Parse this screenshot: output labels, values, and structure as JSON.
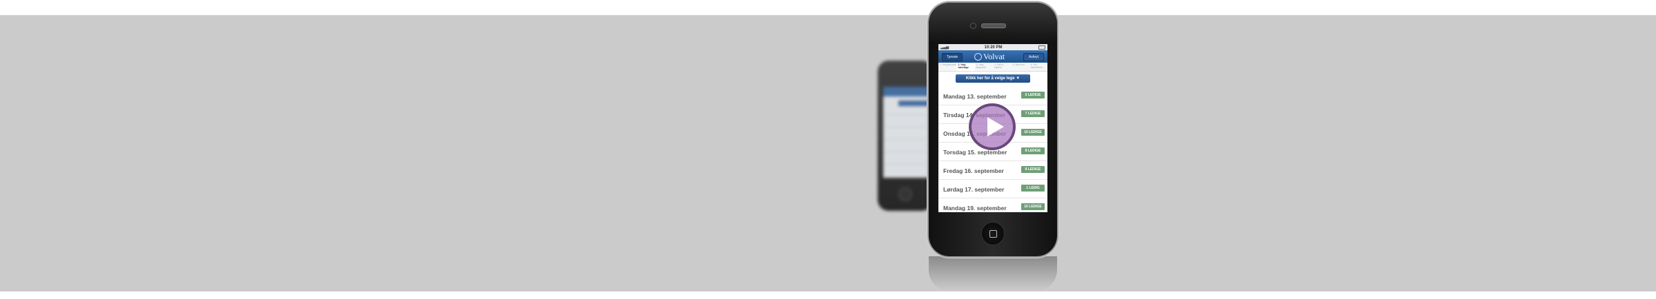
{
  "status_bar": {
    "time": "10:20 PM"
  },
  "nav_bar": {
    "back_label": "Tjenste",
    "logo_text": "Volvat",
    "cancel_label": "Avbryt"
  },
  "steps": [
    {
      "label": "1. Velg tjeneste"
    },
    {
      "label": "2. Velg dato/tage",
      "active": true
    },
    {
      "label": "3. Velg tidspunkt"
    },
    {
      "label": "4. Fyll ut skjema"
    },
    {
      "label": "5. Send inn"
    },
    {
      "label": "6. OK/ bekreftelse"
    }
  ],
  "choose_doctor_button": "Klikk her for å velge lege ▼",
  "days": [
    {
      "label": "Mandag 13. september",
      "badge": "5 LEDIGE"
    },
    {
      "label": "Tirsdag 14. september",
      "badge": "7 LEDIGE"
    },
    {
      "label": "Onsdag 15. september",
      "badge": "10 LEDIGE"
    },
    {
      "label": "Torsdag 15. september",
      "badge": "8 LEDIGE"
    },
    {
      "label": "Fredag 16. september",
      "badge": "8 LEDIGE"
    },
    {
      "label": "Lørdag 17. september",
      "badge": "1 LEDIG"
    },
    {
      "label": "Mandag 19. september",
      "badge": "10 LEDIGE"
    }
  ],
  "colors": {
    "band": "#cbcbcb",
    "nav_blue": "#1f538f",
    "badge_green": "#6e9f76",
    "play_purple": "#aa78be"
  },
  "icons": {
    "play": "play-icon",
    "home": "home-button-icon"
  }
}
